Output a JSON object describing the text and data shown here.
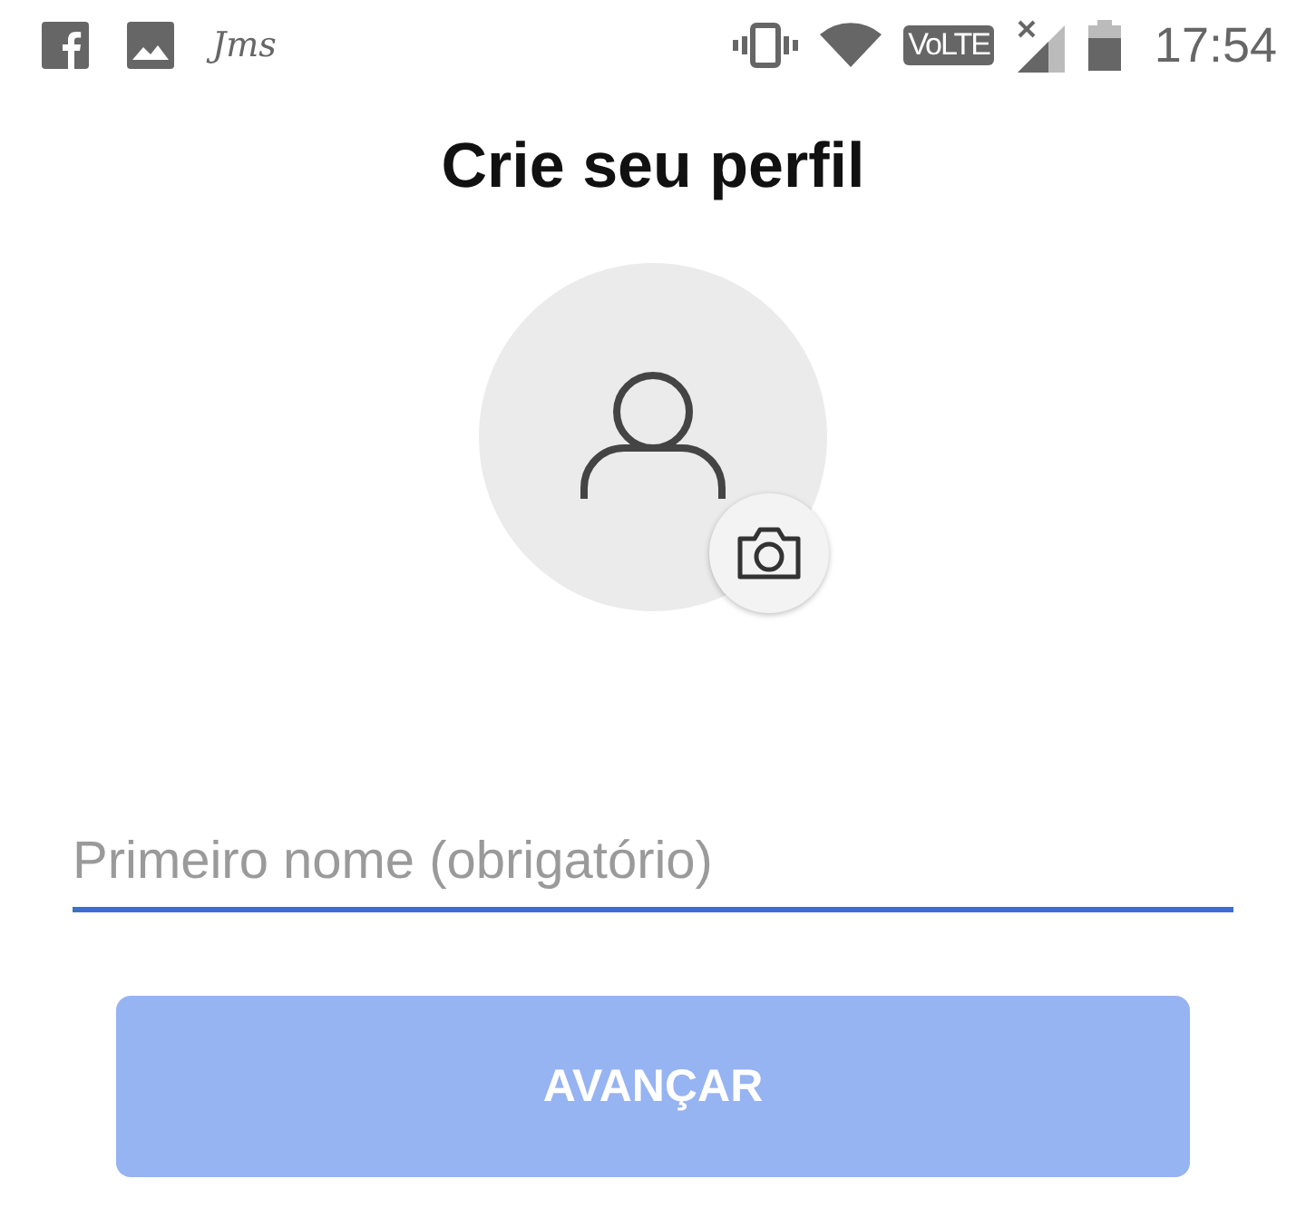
{
  "status_bar": {
    "app_label": "Jms",
    "network_badge": "VoLTE",
    "time": "17:54"
  },
  "title": "Crie seu perfil",
  "name_field": {
    "placeholder": "Primeiro nome (obrigatório)"
  },
  "next_button": {
    "label": "AVANÇAR",
    "disabled": true
  }
}
